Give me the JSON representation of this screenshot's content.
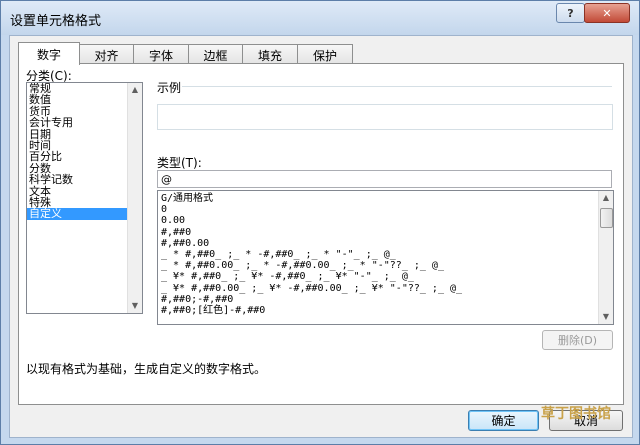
{
  "window": {
    "title": "设置单元格格式"
  },
  "titlebar": {
    "help_label": "?",
    "close_label": "✕"
  },
  "tabs": [
    {
      "label": "数字",
      "active": true
    },
    {
      "label": "对齐",
      "active": false
    },
    {
      "label": "字体",
      "active": false
    },
    {
      "label": "边框",
      "active": false
    },
    {
      "label": "填充",
      "active": false
    },
    {
      "label": "保护",
      "active": false
    }
  ],
  "category": {
    "label": "分类(C):",
    "items": [
      "常规",
      "数值",
      "货币",
      "会计专用",
      "日期",
      "时间",
      "百分比",
      "分数",
      "科学记数",
      "文本",
      "特殊",
      "自定义"
    ],
    "selected": "自定义"
  },
  "sample": {
    "label": "示例",
    "value": ""
  },
  "type": {
    "label": "类型(T):",
    "value": "@",
    "items": [
      "G/通用格式",
      "0",
      "0.00",
      "#,##0",
      "#,##0.00",
      "_ * #,##0_ ;_ * -#,##0_ ;_ * \"-\"_ ;_ @_",
      "_ * #,##0.00_ ;_ * -#,##0.00_ ;_ * \"-\"??_ ;_ @_",
      "_ ¥* #,##0_ ;_ ¥* -#,##0_ ;_ ¥* \"-\"_ ;_ @_",
      "_ ¥* #,##0.00_ ;_ ¥* -#,##0.00_ ;_ ¥* \"-\"??_ ;_ @_",
      "#,##0;-#,##0",
      "#,##0;[红色]-#,##0"
    ]
  },
  "buttons": {
    "delete": "删除(D)",
    "ok": "确定",
    "cancel": "取消"
  },
  "description": "以现有格式为基础，生成自定义的数字格式。",
  "watermark": {
    "text": "草丁图书馆"
  },
  "icons": {
    "scroll_up": "▲",
    "scroll_down": "▼"
  }
}
